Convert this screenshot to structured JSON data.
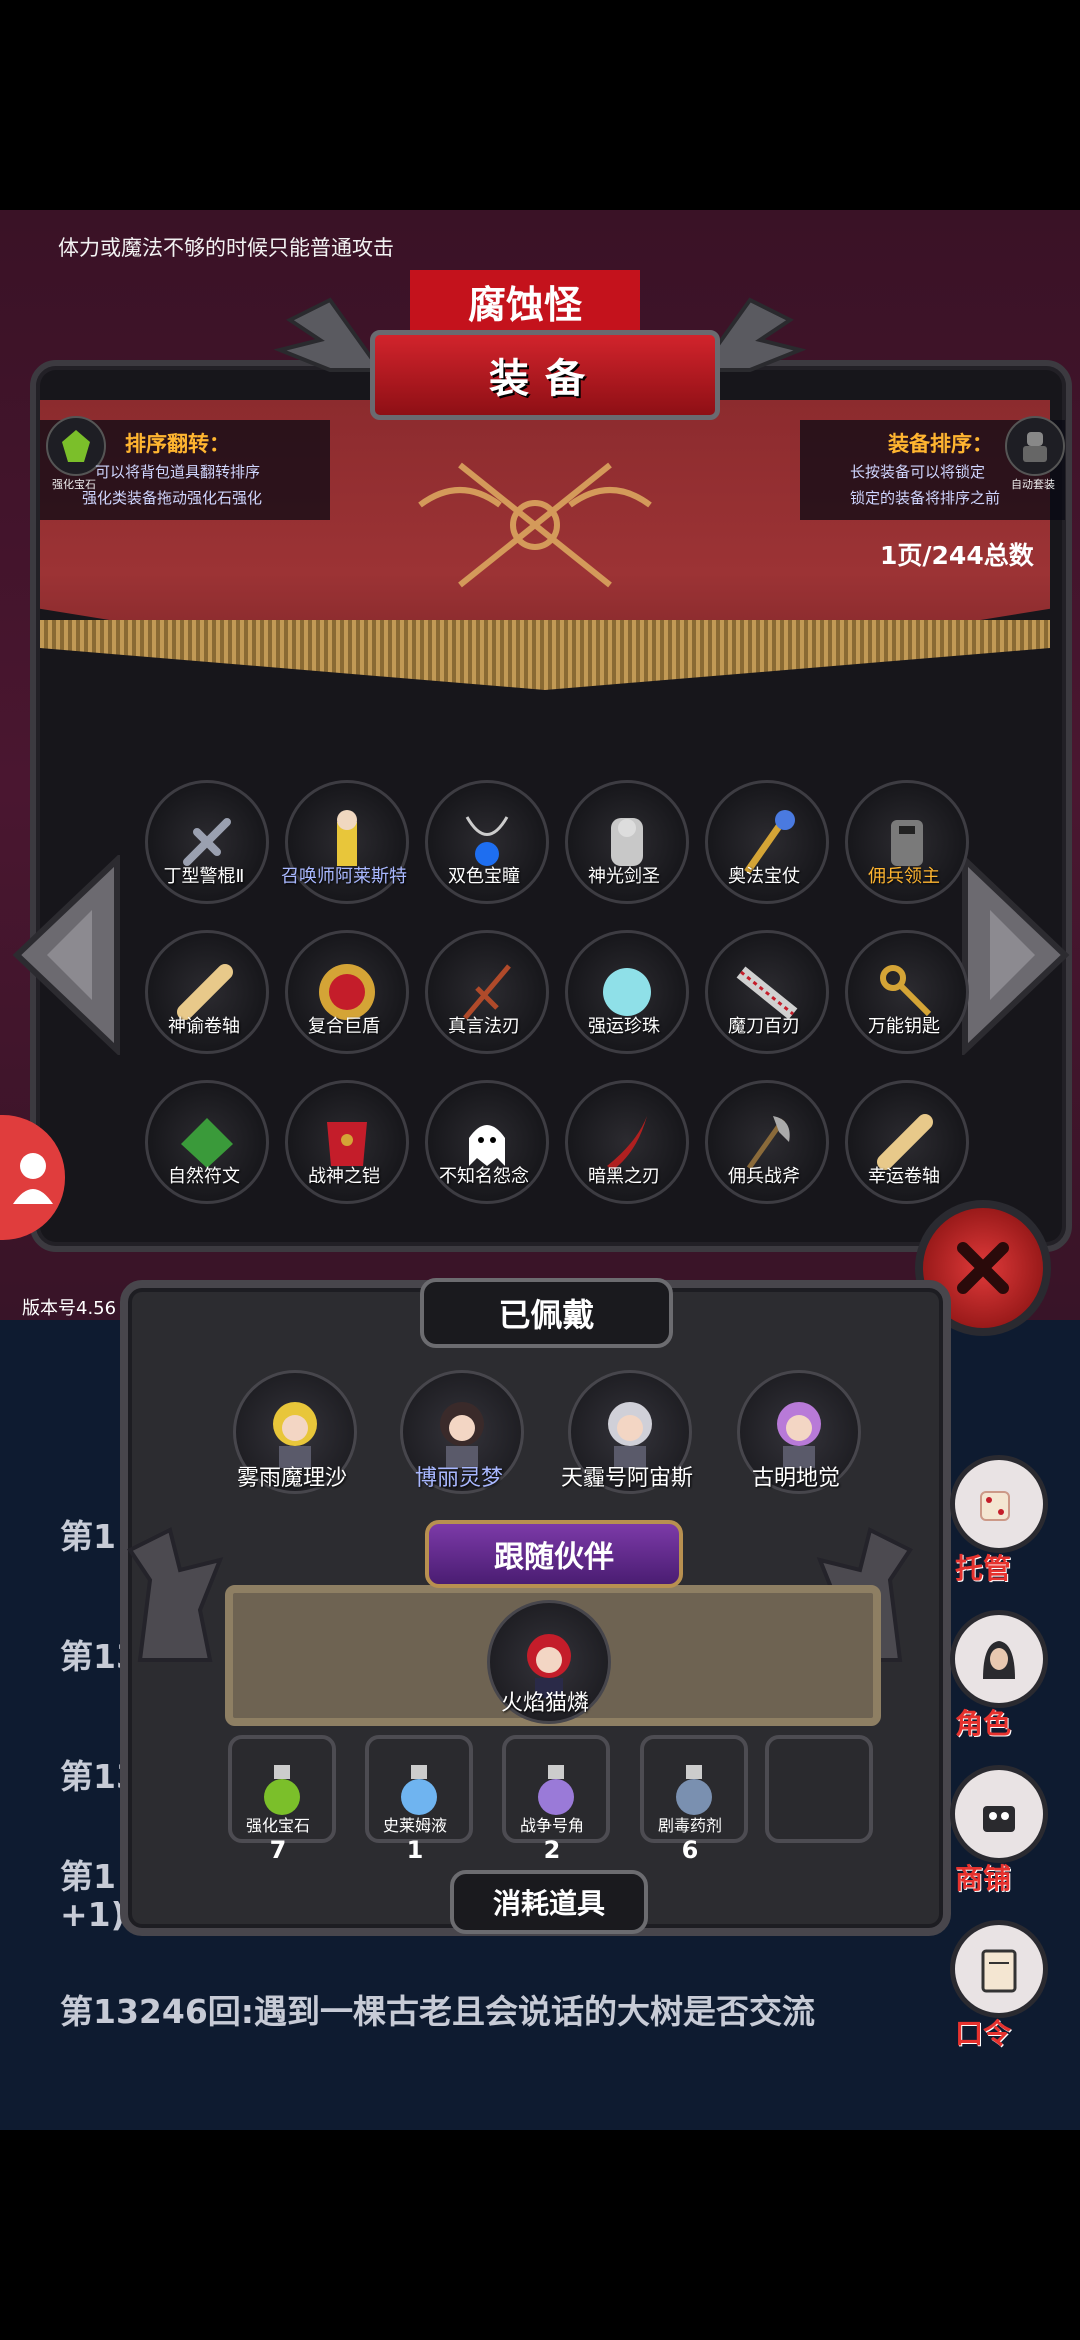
{
  "hint": "体力或魔法不够的时候只能普通攻击",
  "bg_enemy_name": "腐蚀怪",
  "panel_title": "装备",
  "sort_flip": {
    "title": "排序翻转：",
    "line1": "可以将背包道具翻转排序",
    "line2": "强化类装备拖动强化石强化",
    "corner_label": "强化宝石"
  },
  "equip_sort": {
    "title": "装备排序：",
    "line1": "长按装备可以将锁定",
    "line2": "锁定的装备将排序之前",
    "corner_label": "自动套装"
  },
  "page_count": "1页/244总数",
  "grid": [
    {
      "label": "丁型警棍Ⅱ",
      "icon": "baton-icon",
      "color": "white"
    },
    {
      "label": "召唤师阿莱斯特",
      "icon": "summoner-icon",
      "color": "blue"
    },
    {
      "label": "双色宝瞳",
      "icon": "amulet-icon",
      "color": "white"
    },
    {
      "label": "神光剑圣",
      "icon": "knight-icon",
      "color": "white"
    },
    {
      "label": "奥法宝仗",
      "icon": "staff-icon",
      "color": "white"
    },
    {
      "label": "佣兵领主",
      "icon": "mercenary-lord-icon",
      "color": "gold"
    },
    {
      "label": "神谕卷轴",
      "icon": "scroll-icon",
      "color": "white"
    },
    {
      "label": "复合巨盾",
      "icon": "shield-icon",
      "color": "white"
    },
    {
      "label": "真言法刃",
      "icon": "spear-icon",
      "color": "white"
    },
    {
      "label": "强运珍珠",
      "icon": "pearl-icon",
      "color": "white"
    },
    {
      "label": "魔刀百刃",
      "icon": "saw-blade-icon",
      "color": "white"
    },
    {
      "label": "万能钥匙",
      "icon": "key-icon",
      "color": "white"
    },
    {
      "label": "自然符文",
      "icon": "rune-icon",
      "color": "white"
    },
    {
      "label": "战神之铠",
      "icon": "armor-icon",
      "color": "white"
    },
    {
      "label": "不知名怨念",
      "icon": "ghost-icon",
      "color": "white"
    },
    {
      "label": "暗黑之刃",
      "icon": "dark-blade-icon",
      "color": "white"
    },
    {
      "label": "佣兵战斧",
      "icon": "axe-icon",
      "color": "white"
    },
    {
      "label": "幸运卷轴",
      "icon": "scroll-icon",
      "color": "white"
    }
  ],
  "version": "版本号4.56",
  "log": {
    "line1": "第1",
    "line2": "第13",
    "line3": "第13",
    "line4a": "第1",
    "line4b": "+1)",
    "line5": "第13246回:遇到一棵古老且会说话的大树是否交流"
  },
  "worn": {
    "title": "已佩戴",
    "items": [
      {
        "label": "雾雨魔理沙",
        "color": "white"
      },
      {
        "label": "博丽灵梦",
        "color": "blue"
      },
      {
        "label": "天霾号阿宙斯",
        "color": "white"
      },
      {
        "label": "古明地觉",
        "color": "white"
      }
    ]
  },
  "companion": {
    "title": "跟随伙伴",
    "name": "火焰猫燐"
  },
  "consumables": {
    "title": "消耗道具",
    "items": [
      {
        "label": "强化宝石",
        "count": "7"
      },
      {
        "label": "史莱姆液",
        "count": "1"
      },
      {
        "label": "战争号角",
        "count": "2"
      },
      {
        "label": "剧毒药剂",
        "count": "6"
      }
    ]
  },
  "side_menu": [
    {
      "label": "托管",
      "icon": "dice-icon"
    },
    {
      "label": "角色",
      "icon": "hooded-figure-icon"
    },
    {
      "label": "商铺",
      "icon": "shop-icon"
    },
    {
      "label": "口令",
      "icon": "book-icon"
    }
  ],
  "colors": {
    "gold": "#ffb530",
    "blue_label": "#a9b8ff",
    "banner_red": "#9c3335",
    "accent_red": "#e6322e"
  }
}
